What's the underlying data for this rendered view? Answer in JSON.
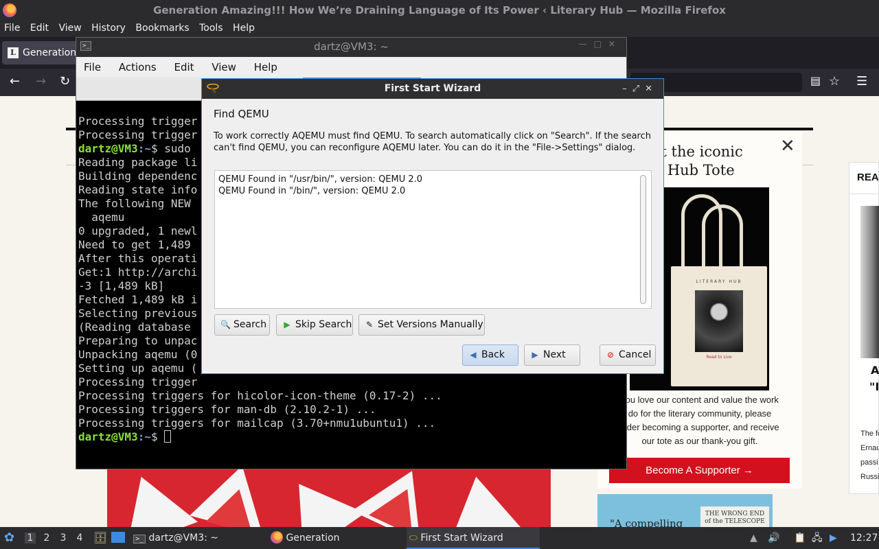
{
  "firefox": {
    "window_title": "Generation Amazing!!! How We’re Draining Language of Its Power ‹ Literary Hub — Mozilla Firefox",
    "menu": [
      "File",
      "Edit",
      "View",
      "History",
      "Bookmarks",
      "Tools",
      "Help"
    ],
    "tab_label": "Generation",
    "tab_favicon": "L"
  },
  "webpage": {
    "popup_title": "et the iconic\nit Hub Tote",
    "tote_brand": "LITERARY HUB",
    "tote_caption": "Read to Live",
    "popup_text": "you love our content and value the work\ndo for the literary community, please\nsider becoming a supporter, and receive\nour tote as our thank-you gift.",
    "supporter_button": "Become A Supporter →",
    "book_cover": "THE WRONG END\nof the TELESCOPE",
    "book_quote": "\"A compelling",
    "right_card_heading": "REA",
    "right_card_a": "A",
    "right_card_quote": "\"I",
    "right_card_snippet": "The fo\nErnau\npassi\nRussi"
  },
  "terminal": {
    "title": "dartz@VM3: ~",
    "menu": [
      "File",
      "Actions",
      "Edit",
      "View",
      "Help"
    ],
    "prompt_user": "dartz@VM3",
    "prompt_path": ":~",
    "prompt_symbol": "$",
    "lines": [
      "Processing trigger",
      "Processing trigger",
      "",
      "Reading package li",
      "Building dependenc",
      "Reading state info",
      "The following NEW ",
      "  aqemu",
      "0 upgraded, 1 newl",
      "Need to get 1,489 ",
      "After this operati",
      "Get:1 http://archi",
      "-3 [1,489 kB]",
      "Fetched 1,489 kB i",
      "Selecting previous",
      "(Reading database ",
      "Preparing to unpac",
      "Unpacking aqemu (0",
      "Setting up aqemu (",
      "Processing trigger",
      "Processing triggers for hicolor-icon-theme (0.17-2) ...",
      "Processing triggers for man-db (2.10.2-1) ...",
      "Processing triggers for mailcap (3.70+nmu1ubuntu1) ..."
    ],
    "command_line": " sudo "
  },
  "wizard": {
    "title": "First Start Wizard",
    "heading": "Find QEMU",
    "description": "To work correctly AQEMU must find QEMU. To search automatically click on \"Search\". If the search can't find QEMU, you can reconfigure AQEMU later. You can do it in the \"File->Settings\" dialog.",
    "results": [
      "QEMU Found in \"/usr/bin/\", version: QEMU 2.0",
      "QEMU Found in \"/bin/\", version: QEMU 2.0"
    ],
    "buttons": {
      "search": "Search",
      "skip_search": "Skip Search",
      "set_versions": "Set Versions Manually",
      "back": "Back",
      "next": "Next",
      "cancel": "Cancel"
    }
  },
  "taskbar": {
    "workspaces": [
      "1",
      "2",
      "3",
      "4"
    ],
    "tasks": [
      "dartz@VM3: ~",
      "Generation Amazing!!...",
      "First Start Wizard"
    ],
    "clock": "12:27"
  },
  "colors": {
    "accent": "#3f8ae0",
    "terminal_user": "#8ae234",
    "terminal_path": "#729fcf",
    "supporter_red": "#d3101d"
  }
}
